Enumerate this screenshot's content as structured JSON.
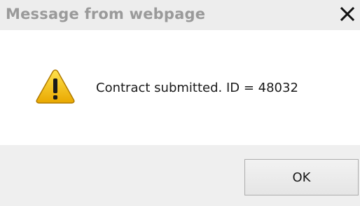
{
  "dialog": {
    "title": "Message from webpage",
    "close_glyph": "✕",
    "icon": "warning-icon",
    "message": "Contract submitted. ID = 48032",
    "ok_label": "OK"
  },
  "colors": {
    "titlebar_bg": "#ededed",
    "title_text": "#9a9a9a",
    "button_bar_bg": "#efefef",
    "warning_yellow": "#f5c400"
  }
}
